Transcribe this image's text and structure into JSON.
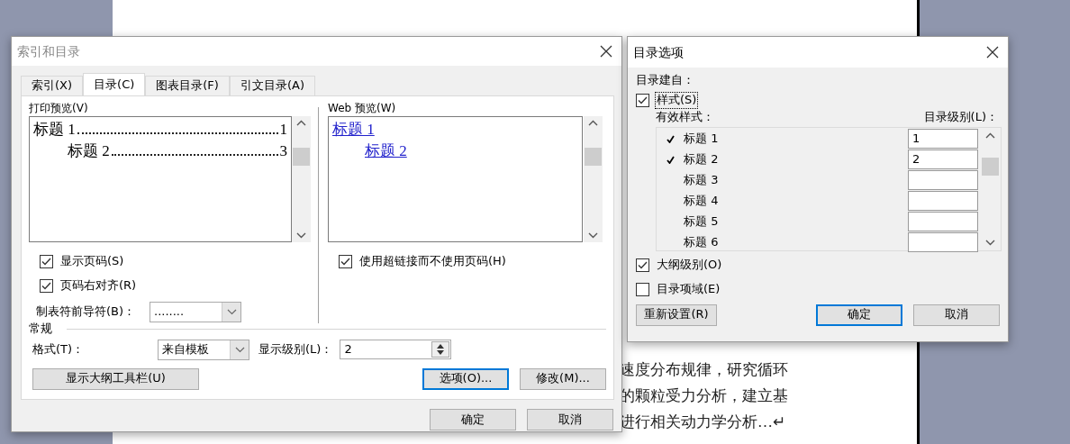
{
  "background_document": {
    "lines": [
      "速度分布规律，研究循环",
      "的颗粒受力分析，建立基",
      "进行相关动力学分析…↵"
    ]
  },
  "index_dialog": {
    "title": "索引和目录",
    "tabs": [
      {
        "label": "索引(X)",
        "selected": false
      },
      {
        "label": "目录(C)",
        "selected": true
      },
      {
        "label": "图表目录(F)",
        "selected": false
      },
      {
        "label": "引文目录(A)",
        "selected": false
      }
    ],
    "print_preview": {
      "label": "打印预览(V)",
      "entries": [
        {
          "text": "标题 1",
          "page": "1",
          "children": [
            {
              "text": "标题 2",
              "page": "3"
            }
          ]
        }
      ]
    },
    "web_preview": {
      "label": "Web 预览(W)",
      "entries": [
        {
          "text": "标题 1",
          "children": [
            {
              "text": "标题 2"
            }
          ]
        }
      ]
    },
    "print_options": [
      {
        "label": "显示页码(S)",
        "checked": true
      },
      {
        "label": "页码右对齐(R)",
        "checked": true
      }
    ],
    "tab_leader": {
      "label": "制表符前导符(B)：",
      "value": "........"
    },
    "web_options": [
      {
        "label": "使用超链接而不使用页码(H)",
        "checked": true
      }
    ],
    "general": {
      "heading": "常规",
      "format": {
        "label": "格式(T)：",
        "value": "来自模板"
      },
      "show_levels": {
        "label": "显示级别(L)：",
        "value": "2"
      }
    },
    "outline_button": "显示大纲工具栏(U)",
    "action_buttons": [
      {
        "label": "选项(O)...",
        "default": true
      },
      {
        "label": "修改(M)...",
        "default": false
      }
    ],
    "footer_buttons": [
      {
        "label": "确定",
        "default": false
      },
      {
        "label": "取消",
        "default": false
      }
    ]
  },
  "options_dialog": {
    "title": "目录选项",
    "built_from": "目录建自：",
    "styles_option": {
      "label": "样式(S)",
      "checked": true,
      "focused": true
    },
    "styles_header": "有效样式：",
    "level_header": "目录级别(L)：",
    "styles": [
      {
        "name": "标题 1",
        "checked": true,
        "level": "1"
      },
      {
        "name": "标题 2",
        "checked": true,
        "level": "2"
      },
      {
        "name": "标题 3",
        "checked": false
      },
      {
        "name": "标题 4",
        "checked": false
      },
      {
        "name": "标题 5",
        "checked": false
      },
      {
        "name": "标题 6",
        "checked": false
      }
    ],
    "outline_option": {
      "label": "大纲级别(O)",
      "checked": true,
      "focused": false
    },
    "fields_option": {
      "label": "目录项域(E)",
      "checked": false,
      "focused": false
    },
    "reset_button": "重新设置(R)",
    "buttons": [
      {
        "label": "确定",
        "default": true
      },
      {
        "label": "取消",
        "default": false
      }
    ]
  }
}
